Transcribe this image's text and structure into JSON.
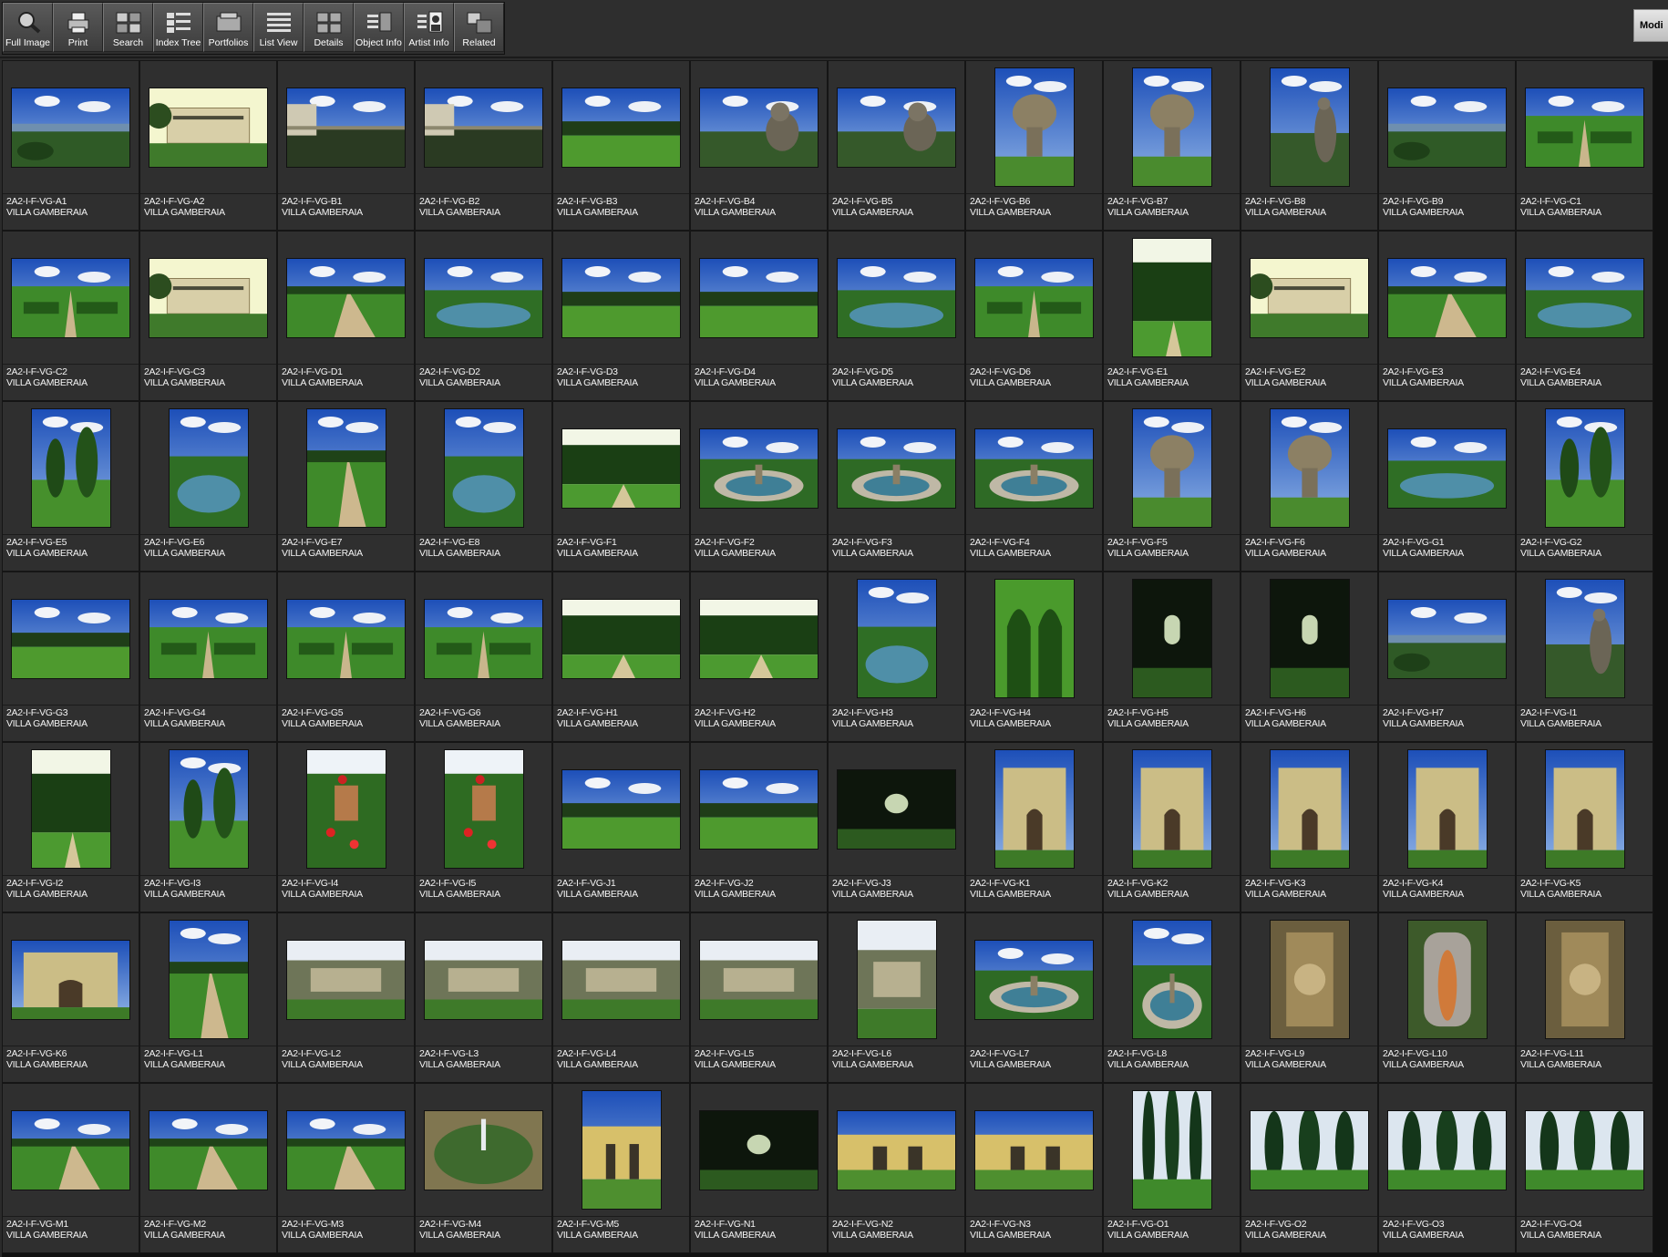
{
  "toolbar": {
    "tools": [
      {
        "label": "Full Image",
        "icon": "magnifier-icon"
      },
      {
        "label": "Print",
        "icon": "printer-icon"
      },
      {
        "label": "Search",
        "icon": "search-grid-icon"
      },
      {
        "label": "Index Tree",
        "icon": "index-tree-icon"
      },
      {
        "label": "Portfolios",
        "icon": "portfolio-icon"
      },
      {
        "label": "List View",
        "icon": "list-view-icon"
      },
      {
        "label": "Details",
        "icon": "details-icon"
      },
      {
        "label": "Object Info",
        "icon": "object-info-icon"
      },
      {
        "label": "Artist  Info",
        "icon": "artist-info-icon"
      },
      {
        "label": "Related",
        "icon": "related-icon"
      }
    ],
    "modify_label": "Modi"
  },
  "records": [
    {
      "id": "2A2-I-F-VG-A1",
      "title": "VILLA GAMBERAIA",
      "o": "l",
      "scene": "vista"
    },
    {
      "id": "2A2-I-F-VG-A2",
      "title": "VILLA GAMBERAIA",
      "o": "l",
      "scene": "villa"
    },
    {
      "id": "2A2-I-F-VG-B1",
      "title": "VILLA GAMBERAIA",
      "o": "l",
      "scene": "terrace"
    },
    {
      "id": "2A2-I-F-VG-B2",
      "title": "VILLA GAMBERAIA",
      "o": "l",
      "scene": "terrace"
    },
    {
      "id": "2A2-I-F-VG-B3",
      "title": "VILLA GAMBERAIA",
      "o": "l",
      "scene": "lawn"
    },
    {
      "id": "2A2-I-F-VG-B4",
      "title": "VILLA GAMBERAIA",
      "o": "l",
      "scene": "statue"
    },
    {
      "id": "2A2-I-F-VG-B5",
      "title": "VILLA GAMBERAIA",
      "o": "l",
      "scene": "statue"
    },
    {
      "id": "2A2-I-F-VG-B6",
      "title": "VILLA GAMBERAIA",
      "o": "p",
      "scene": "urn"
    },
    {
      "id": "2A2-I-F-VG-B7",
      "title": "VILLA GAMBERAIA",
      "o": "p",
      "scene": "urn"
    },
    {
      "id": "2A2-I-F-VG-B8",
      "title": "VILLA GAMBERAIA",
      "o": "p",
      "scene": "statue"
    },
    {
      "id": "2A2-I-F-VG-B9",
      "title": "VILLA GAMBERAIA",
      "o": "l",
      "scene": "vista"
    },
    {
      "id": "2A2-I-F-VG-C1",
      "title": "VILLA GAMBERAIA",
      "o": "l",
      "scene": "parterre"
    },
    {
      "id": "2A2-I-F-VG-C2",
      "title": "VILLA GAMBERAIA",
      "o": "l",
      "scene": "parterre"
    },
    {
      "id": "2A2-I-F-VG-C3",
      "title": "VILLA GAMBERAIA",
      "o": "l",
      "scene": "villa"
    },
    {
      "id": "2A2-I-F-VG-D1",
      "title": "VILLA GAMBERAIA",
      "o": "l",
      "scene": "path"
    },
    {
      "id": "2A2-I-F-VG-D2",
      "title": "VILLA GAMBERAIA",
      "o": "l",
      "scene": "pool"
    },
    {
      "id": "2A2-I-F-VG-D3",
      "title": "VILLA GAMBERAIA",
      "o": "l",
      "scene": "lawn"
    },
    {
      "id": "2A2-I-F-VG-D4",
      "title": "VILLA GAMBERAIA",
      "o": "l",
      "scene": "lawn"
    },
    {
      "id": "2A2-I-F-VG-D5",
      "title": "VILLA GAMBERAIA",
      "o": "l",
      "scene": "pool"
    },
    {
      "id": "2A2-I-F-VG-D6",
      "title": "VILLA GAMBERAIA",
      "o": "l",
      "scene": "parterre"
    },
    {
      "id": "2A2-I-F-VG-E1",
      "title": "VILLA GAMBERAIA",
      "o": "p",
      "scene": "hedge"
    },
    {
      "id": "2A2-I-F-VG-E2",
      "title": "VILLA GAMBERAIA",
      "o": "l",
      "scene": "villa"
    },
    {
      "id": "2A2-I-F-VG-E3",
      "title": "VILLA GAMBERAIA",
      "o": "l",
      "scene": "path"
    },
    {
      "id": "2A2-I-F-VG-E4",
      "title": "VILLA GAMBERAIA",
      "o": "l",
      "scene": "pool"
    },
    {
      "id": "2A2-I-F-VG-E5",
      "title": "VILLA GAMBERAIA",
      "o": "p",
      "scene": "topiary"
    },
    {
      "id": "2A2-I-F-VG-E6",
      "title": "VILLA GAMBERAIA",
      "o": "p",
      "scene": "pool"
    },
    {
      "id": "2A2-I-F-VG-E7",
      "title": "VILLA GAMBERAIA",
      "o": "p",
      "scene": "path"
    },
    {
      "id": "2A2-I-F-VG-E8",
      "title": "VILLA GAMBERAIA",
      "o": "p",
      "scene": "pool"
    },
    {
      "id": "2A2-I-F-VG-F1",
      "title": "VILLA GAMBERAIA",
      "o": "l",
      "scene": "hedge"
    },
    {
      "id": "2A2-I-F-VG-F2",
      "title": "VILLA GAMBERAIA",
      "o": "l",
      "scene": "fountain"
    },
    {
      "id": "2A2-I-F-VG-F3",
      "title": "VILLA GAMBERAIA",
      "o": "l",
      "scene": "fountain"
    },
    {
      "id": "2A2-I-F-VG-F4",
      "title": "VILLA GAMBERAIA",
      "o": "l",
      "scene": "fountain"
    },
    {
      "id": "2A2-I-F-VG-F5",
      "title": "VILLA GAMBERAIA",
      "o": "p",
      "scene": "urn"
    },
    {
      "id": "2A2-I-F-VG-F6",
      "title": "VILLA GAMBERAIA",
      "o": "p",
      "scene": "urn"
    },
    {
      "id": "2A2-I-F-VG-G1",
      "title": "VILLA GAMBERAIA",
      "o": "l",
      "scene": "pool"
    },
    {
      "id": "2A2-I-F-VG-G2",
      "title": "VILLA GAMBERAIA",
      "o": "p",
      "scene": "topiary"
    },
    {
      "id": "2A2-I-F-VG-G3",
      "title": "VILLA GAMBERAIA",
      "o": "l",
      "scene": "lawn"
    },
    {
      "id": "2A2-I-F-VG-G4",
      "title": "VILLA GAMBERAIA",
      "o": "l",
      "scene": "parterre"
    },
    {
      "id": "2A2-I-F-VG-G5",
      "title": "VILLA GAMBERAIA",
      "o": "l",
      "scene": "parterre"
    },
    {
      "id": "2A2-I-F-VG-G6",
      "title": "VILLA GAMBERAIA",
      "o": "l",
      "scene": "parterre"
    },
    {
      "id": "2A2-I-F-VG-H1",
      "title": "VILLA GAMBERAIA",
      "o": "l",
      "scene": "hedge"
    },
    {
      "id": "2A2-I-F-VG-H2",
      "title": "VILLA GAMBERAIA",
      "o": "l",
      "scene": "hedge"
    },
    {
      "id": "2A2-I-F-VG-H3",
      "title": "VILLA GAMBERAIA",
      "o": "p",
      "scene": "pool"
    },
    {
      "id": "2A2-I-F-VG-H4",
      "title": "VILLA GAMBERAIA",
      "o": "p",
      "scene": "arches"
    },
    {
      "id": "2A2-I-F-VG-H5",
      "title": "VILLA GAMBERAIA",
      "o": "p",
      "scene": "dark"
    },
    {
      "id": "2A2-I-F-VG-H6",
      "title": "VILLA GAMBERAIA",
      "o": "p",
      "scene": "dark"
    },
    {
      "id": "2A2-I-F-VG-H7",
      "title": "VILLA GAMBERAIA",
      "o": "l",
      "scene": "vista"
    },
    {
      "id": "2A2-I-F-VG-I1",
      "title": "VILLA GAMBERAIA",
      "o": "p",
      "scene": "statue"
    },
    {
      "id": "2A2-I-F-VG-I2",
      "title": "VILLA GAMBERAIA",
      "o": "p",
      "scene": "hedge"
    },
    {
      "id": "2A2-I-F-VG-I3",
      "title": "VILLA GAMBERAIA",
      "o": "p",
      "scene": "topiary"
    },
    {
      "id": "2A2-I-F-VG-I4",
      "title": "VILLA GAMBERAIA",
      "o": "p",
      "scene": "flowers"
    },
    {
      "id": "2A2-I-F-VG-I5",
      "title": "VILLA GAMBERAIA",
      "o": "p",
      "scene": "flowers"
    },
    {
      "id": "2A2-I-F-VG-J1",
      "title": "VILLA GAMBERAIA",
      "o": "l",
      "scene": "lawn"
    },
    {
      "id": "2A2-I-F-VG-J2",
      "title": "VILLA GAMBERAIA",
      "o": "l",
      "scene": "lawn"
    },
    {
      "id": "2A2-I-F-VG-J3",
      "title": "VILLA GAMBERAIA",
      "o": "l",
      "scene": "dark"
    },
    {
      "id": "2A2-I-F-VG-K1",
      "title": "VILLA GAMBERAIA",
      "o": "p",
      "scene": "facade"
    },
    {
      "id": "2A2-I-F-VG-K2",
      "title": "VILLA GAMBERAIA",
      "o": "p",
      "scene": "facade"
    },
    {
      "id": "2A2-I-F-VG-K3",
      "title": "VILLA GAMBERAIA",
      "o": "p",
      "scene": "facade"
    },
    {
      "id": "2A2-I-F-VG-K4",
      "title": "VILLA GAMBERAIA",
      "o": "p",
      "scene": "facade"
    },
    {
      "id": "2A2-I-F-VG-K5",
      "title": "VILLA GAMBERAIA",
      "o": "p",
      "scene": "facade"
    },
    {
      "id": "2A2-I-F-VG-K6",
      "title": "VILLA GAMBERAIA",
      "o": "l",
      "scene": "facade"
    },
    {
      "id": "2A2-I-F-VG-L1",
      "title": "VILLA GAMBERAIA",
      "o": "p",
      "scene": "path"
    },
    {
      "id": "2A2-I-F-VG-L2",
      "title": "VILLA GAMBERAIA",
      "o": "l",
      "scene": "grotto"
    },
    {
      "id": "2A2-I-F-VG-L3",
      "title": "VILLA GAMBERAIA",
      "o": "l",
      "scene": "grotto"
    },
    {
      "id": "2A2-I-F-VG-L4",
      "title": "VILLA GAMBERAIA",
      "o": "l",
      "scene": "grotto"
    },
    {
      "id": "2A2-I-F-VG-L5",
      "title": "VILLA GAMBERAIA",
      "o": "l",
      "scene": "grotto"
    },
    {
      "id": "2A2-I-F-VG-L6",
      "title": "VILLA GAMBERAIA",
      "o": "p",
      "scene": "grotto"
    },
    {
      "id": "2A2-I-F-VG-L7",
      "title": "VILLA GAMBERAIA",
      "o": "l",
      "scene": "fountain"
    },
    {
      "id": "2A2-I-F-VG-L8",
      "title": "VILLA GAMBERAIA",
      "o": "p",
      "scene": "fountain"
    },
    {
      "id": "2A2-I-F-VG-L9",
      "title": "VILLA GAMBERAIA",
      "o": "p",
      "scene": "stone"
    },
    {
      "id": "2A2-I-F-VG-L10",
      "title": "VILLA GAMBERAIA",
      "o": "p",
      "scene": "niche"
    },
    {
      "id": "2A2-I-F-VG-L11",
      "title": "VILLA GAMBERAIA",
      "o": "p",
      "scene": "stone"
    },
    {
      "id": "2A2-I-F-VG-M1",
      "title": "VILLA GAMBERAIA",
      "o": "l",
      "scene": "path"
    },
    {
      "id": "2A2-I-F-VG-M2",
      "title": "VILLA GAMBERAIA",
      "o": "l",
      "scene": "path"
    },
    {
      "id": "2A2-I-F-VG-M3",
      "title": "VILLA GAMBERAIA",
      "o": "l",
      "scene": "path"
    },
    {
      "id": "2A2-I-F-VG-M4",
      "title": "VILLA GAMBERAIA",
      "o": "l",
      "scene": "basin"
    },
    {
      "id": "2A2-I-F-VG-M5",
      "title": "VILLA GAMBERAIA",
      "o": "p",
      "scene": "building"
    },
    {
      "id": "2A2-I-F-VG-N1",
      "title": "VILLA GAMBERAIA",
      "o": "l",
      "scene": "dark"
    },
    {
      "id": "2A2-I-F-VG-N2",
      "title": "VILLA GAMBERAIA",
      "o": "l",
      "scene": "building"
    },
    {
      "id": "2A2-I-F-VG-N3",
      "title": "VILLA GAMBERAIA",
      "o": "l",
      "scene": "building"
    },
    {
      "id": "2A2-I-F-VG-O1",
      "title": "VILLA GAMBERAIA",
      "o": "p",
      "scene": "cypress"
    },
    {
      "id": "2A2-I-F-VG-O2",
      "title": "VILLA GAMBERAIA",
      "o": "l",
      "scene": "cypress"
    },
    {
      "id": "2A2-I-F-VG-O3",
      "title": "VILLA GAMBERAIA",
      "o": "l",
      "scene": "cypress"
    },
    {
      "id": "2A2-I-F-VG-O4",
      "title": "VILLA GAMBERAIA",
      "o": "l",
      "scene": "cypress"
    }
  ]
}
